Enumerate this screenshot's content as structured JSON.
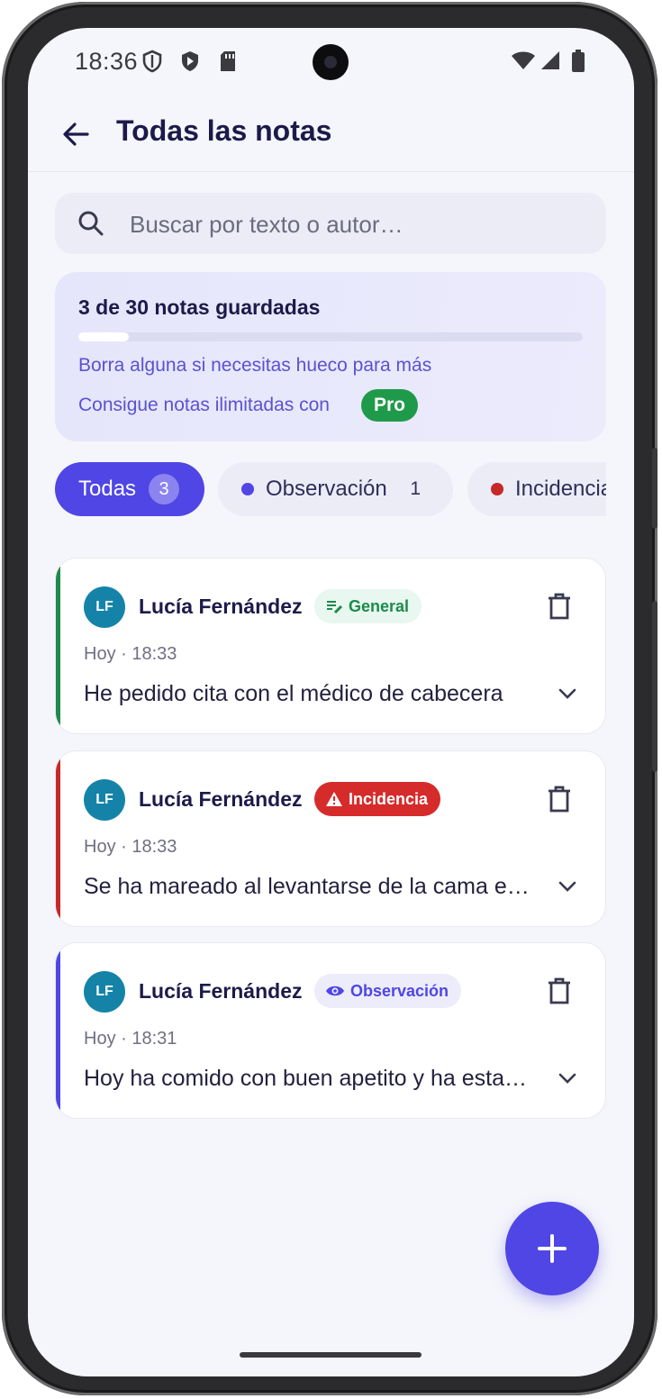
{
  "status_bar": {
    "time": "18:36"
  },
  "app_bar": {
    "title": "Todas las notas"
  },
  "search": {
    "placeholder": "Buscar por texto o autor…"
  },
  "quota": {
    "count_text": "3 de 30 notas guardadas",
    "used": 3,
    "limit": 30,
    "hint": "Borra alguna si necesitas hueco para más",
    "upsell": "Consigue notas ilimitadas con",
    "pro_badge": "Pro"
  },
  "filters": [
    {
      "label": "Todas",
      "count": "3",
      "active": true
    },
    {
      "label": "Observación",
      "count": "1",
      "color": "#4f46e5"
    },
    {
      "label": "Incidencia",
      "color": "#c62828"
    }
  ],
  "notes": [
    {
      "initials": "LF",
      "author": "Lucía Fernández",
      "tag": "General",
      "tag_icon": "edit-note-icon",
      "tag_bg": "#e8f7ef",
      "tag_color": "#1d8a4c",
      "accent": "#1d8a4c",
      "time": "Hoy · 18:33",
      "text": "He pedido cita con el médico de cabecera"
    },
    {
      "initials": "LF",
      "author": "Lucía Fernández",
      "tag": "Incidencia",
      "tag_icon": "warning-icon",
      "tag_bg": "#d62b2b",
      "tag_color": "#ffffff",
      "accent": "#c62828",
      "time": "Hoy · 18:33",
      "text": "Se ha mareado al levantarse de la cama esta mañana"
    },
    {
      "initials": "LF",
      "author": "Lucía Fernández",
      "tag": "Observación",
      "tag_icon": "eye-icon",
      "tag_bg": "#ececfb",
      "tag_color": "#4f46e5",
      "accent": "#4f46e5",
      "time": "Hoy · 18:31",
      "text": "Hoy ha comido con buen apetito y ha estado tranquila"
    }
  ],
  "colors": {
    "primary": "#4f46e5",
    "pro": "#1f9a4a",
    "avatar": "#1583a8"
  }
}
